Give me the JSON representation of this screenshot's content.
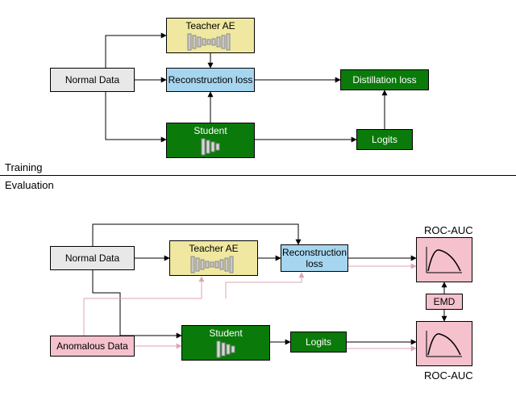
{
  "sections": {
    "training_label": "Training",
    "evaluation_label": "Evaluation"
  },
  "nodes": {
    "normal_data": "Normal Data",
    "teacher_ae": "Teacher AE",
    "reconstruction_loss": "Reconstruction loss",
    "distillation_loss": "Distillation loss",
    "student": "Student",
    "logits": "Logits",
    "anomalous_data": "Anomalous Data",
    "roc_auc": "ROC-AUC",
    "emd": "EMD"
  },
  "icons": {
    "autoencoder": "autoencoder-bars-icon",
    "encoder_bars": "encoder-bars-icon",
    "roc_curve": "roc-curve-icon"
  },
  "colors": {
    "gray": "#e8e8e8",
    "yellow": "#f0e8a0",
    "blue": "#a6d6ef",
    "green": "#0a7a0a",
    "pink": "#f4c1cc",
    "arrow_black": "#000000",
    "arrow_pink": "#f4c1cc"
  },
  "diagram": {
    "type": "flowchart",
    "training_edges": [
      [
        "Normal Data",
        "Teacher AE"
      ],
      [
        "Normal Data",
        "Reconstruction loss"
      ],
      [
        "Normal Data",
        "Student"
      ],
      [
        "Teacher AE",
        "Reconstruction loss"
      ],
      [
        "Reconstruction loss",
        "Distillation loss"
      ],
      [
        "Student",
        "Reconstruction loss"
      ],
      [
        "Student",
        "Logits"
      ],
      [
        "Logits",
        "Distillation loss"
      ]
    ],
    "evaluation_edges_black": [
      [
        "Normal Data",
        "Teacher AE"
      ],
      [
        "Normal Data",
        "Reconstruction loss"
      ],
      [
        "Normal Data",
        "Student"
      ],
      [
        "Teacher AE",
        "Reconstruction loss"
      ],
      [
        "Reconstruction loss",
        "ROC-AUC (top)"
      ],
      [
        "Student",
        "Logits"
      ],
      [
        "Logits",
        "ROC-AUC (bottom)"
      ],
      [
        "ROC-AUC (top)",
        "EMD"
      ],
      [
        "ROC-AUC (bottom)",
        "EMD"
      ]
    ],
    "evaluation_edges_pink": [
      [
        "Anomalous Data",
        "Student"
      ],
      [
        "Anomalous Data",
        "Teacher AE"
      ],
      [
        "Anomalous Data",
        "Reconstruction loss"
      ],
      [
        "Reconstruction loss",
        "ROC-AUC (top)"
      ],
      [
        "Logits",
        "ROC-AUC (bottom)"
      ]
    ]
  }
}
